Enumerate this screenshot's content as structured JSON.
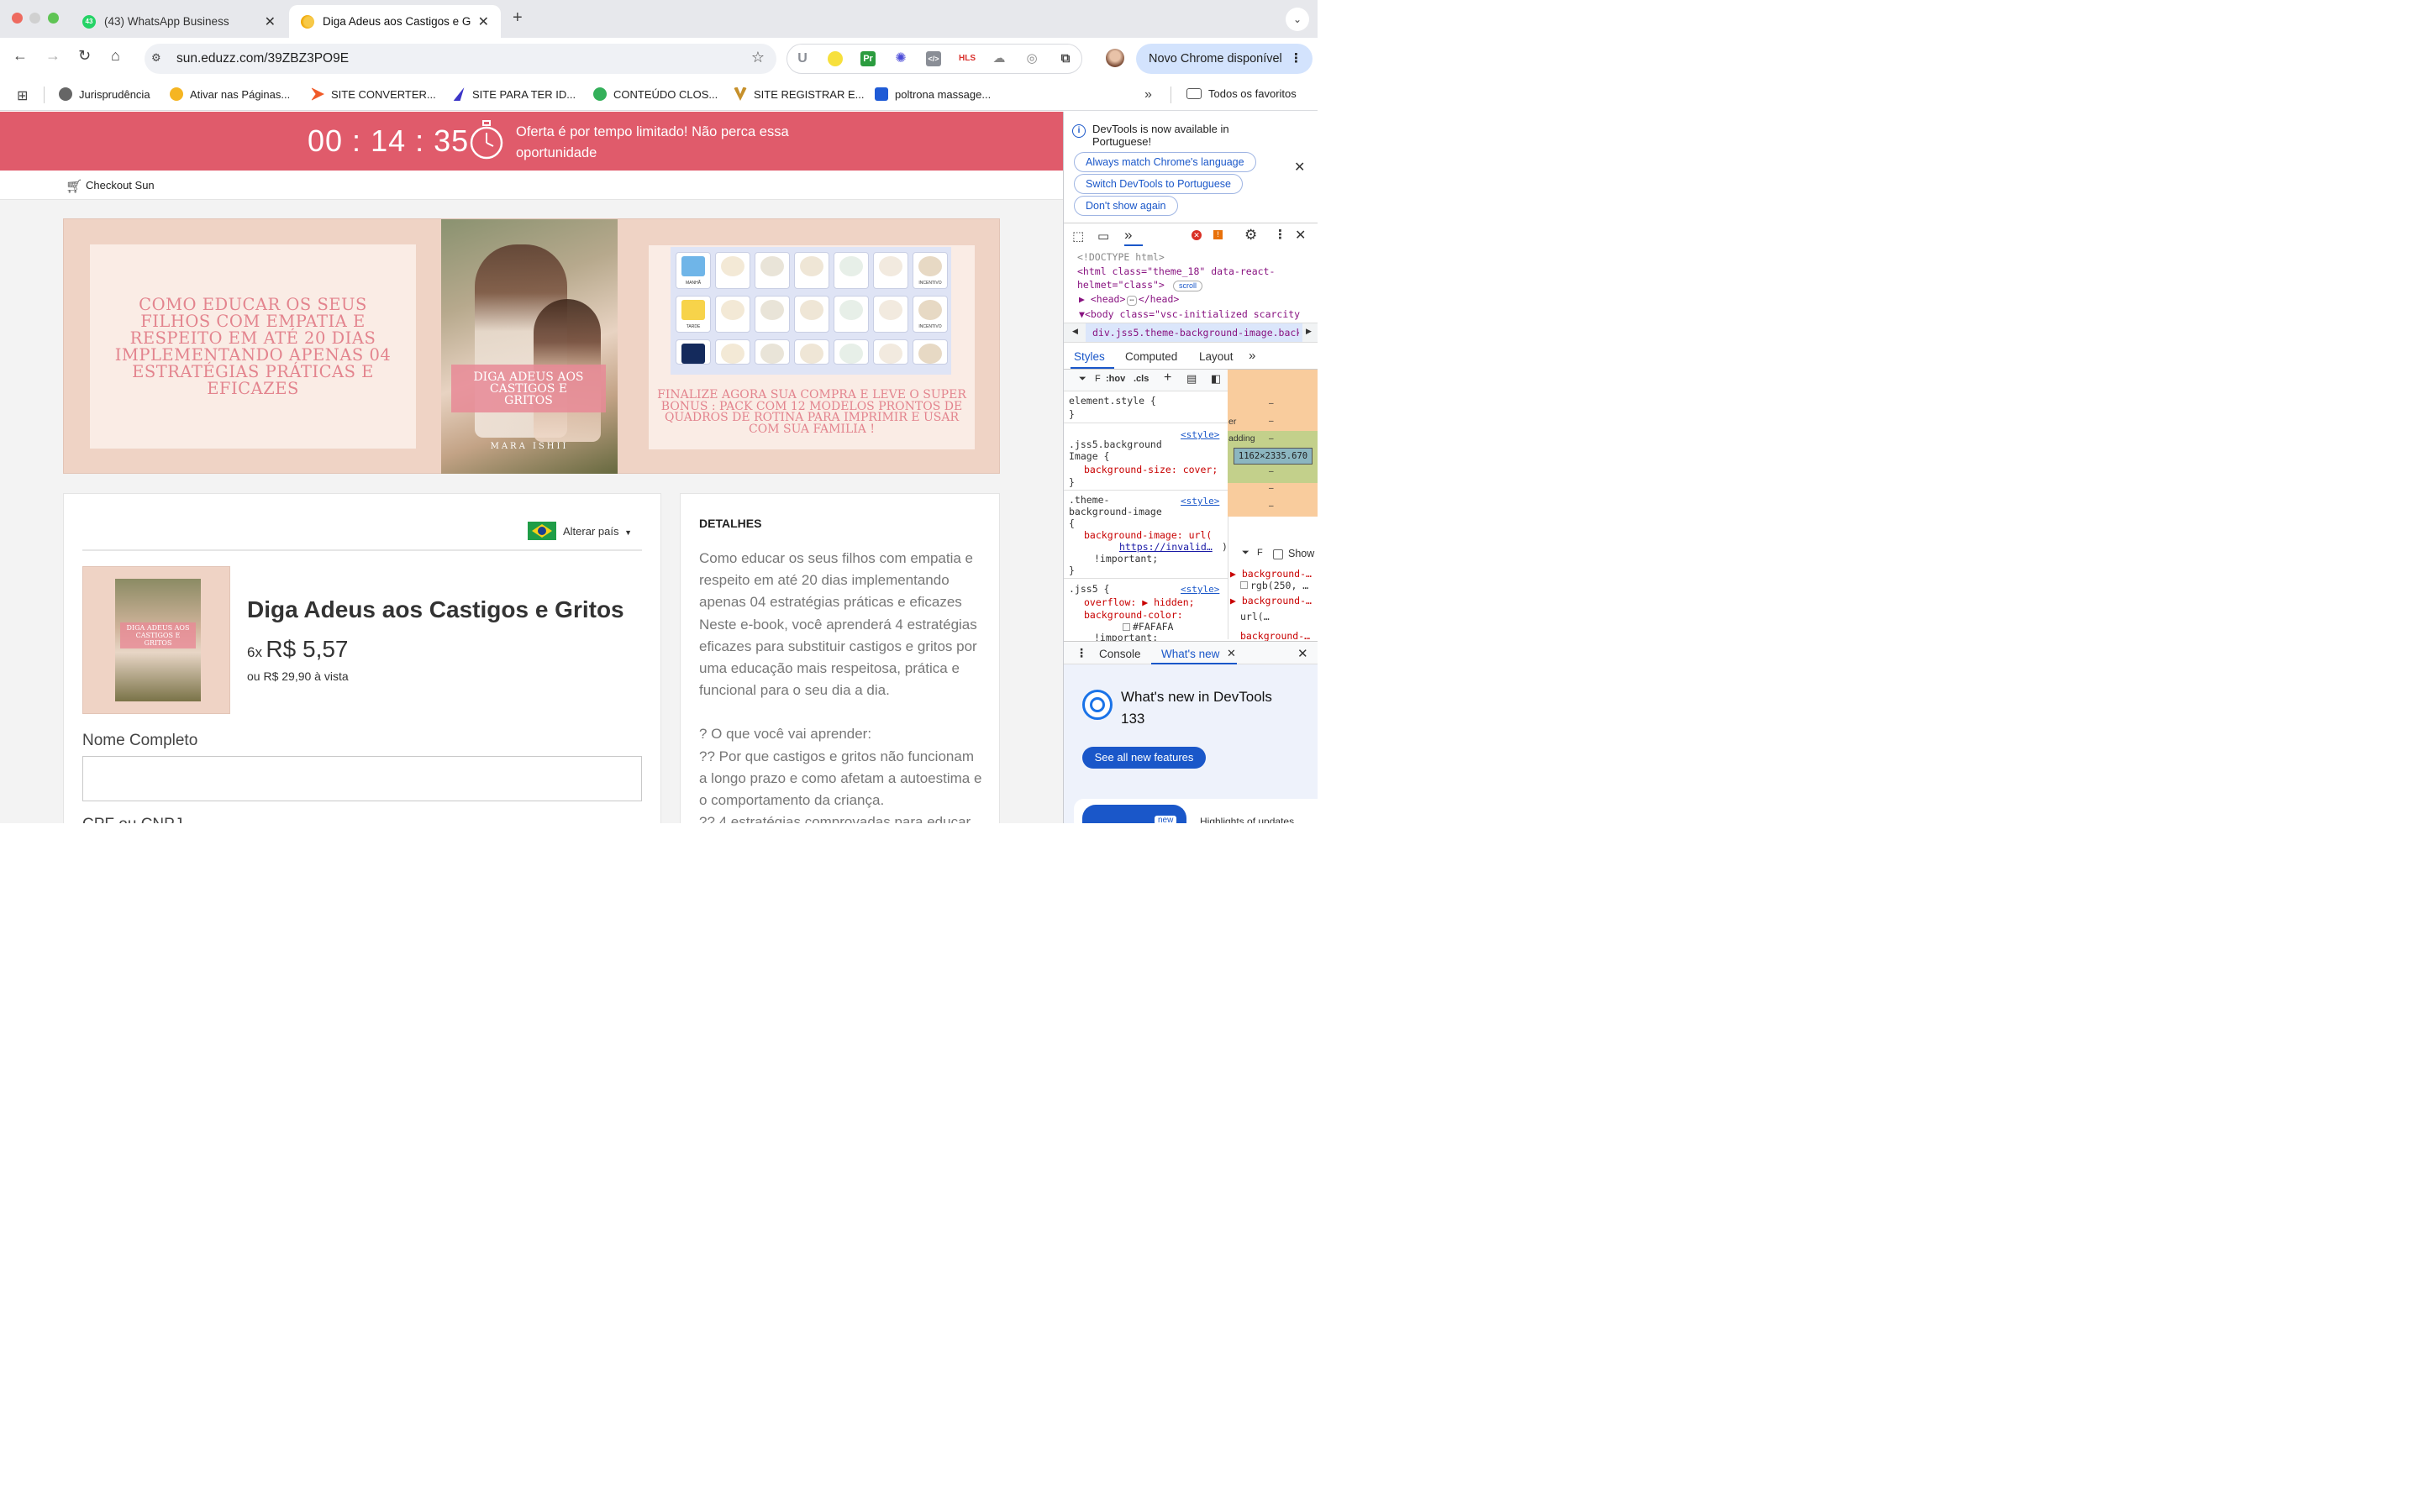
{
  "browser": {
    "tabs": [
      {
        "title": "(43) WhatsApp Business",
        "badge": "43"
      },
      {
        "title": "Diga Adeus aos Castigos e Gr"
      }
    ],
    "new_tab": "+",
    "url": "sun.eduzz.com/39ZBZ3PO9E",
    "update_button": "Novo Chrome disponível",
    "ext_labels": {
      "u": "U",
      "pr": "Pr",
      "hls": "HLS"
    },
    "bookmarks": [
      "Jurisprudência",
      "Ativar nas Páginas...",
      "SITE CONVERTER...",
      "SITE PARA TER ID...",
      "CONTEÚDO CLOS...",
      "SITE REGISTRAR E...",
      "poltrona massage..."
    ],
    "all_bookmarks": "Todos os favoritos"
  },
  "page": {
    "timer": {
      "hh": "00",
      "mm": "14",
      "ss": "35"
    },
    "offer_text": "Oferta é por tempo limitado! Não perca essa oportunidade",
    "checkout_label": "Checkout Sun",
    "hero": {
      "headline": "COMO EDUCAR OS SEUS FILHOS COM EMPATIA E RESPEITO EM ATÉ 20 DIAS IMPLEMENTANDO APENAS 04 ESTRATÉGIAS PRÁTICAS E EFICAZES",
      "book_title": "DIGA ADEUS AOS CASTIGOS E GRITOS",
      "author": "MARA ISHII",
      "bonus": "FINALIZE AGORA SUA COMPRA E LEVE O SUPER BONUS : PACK COM 12 MODELOS PRONTOS DE QUADROS DE ROTINA  PARA IMPRIMIR E USAR COM SUA FAMILIA !",
      "routine_labels": [
        "MANHÃ",
        "TARDE"
      ],
      "routine_incentive": "INCENTIVO"
    },
    "country_change": "Alterar país",
    "product": {
      "title": "Diga Adeus aos Castigos e Gritos",
      "installments": "6x",
      "installment_price": "R$ 5,57",
      "cash_price": "ou R$ 29,90 à vista",
      "thumb_title": "DIGA ADEUS AOS CASTIGOS E GRITOS"
    },
    "form": {
      "name_label": "Nome Completo",
      "name_value": "",
      "cpf_label": "CPF ou CNPJ"
    },
    "details": {
      "heading": "DETALHES",
      "lines": [
        "Como educar os seus filhos com empatia e respeito em até 20 dias implementando apenas 04 estratégias práticas e eficazes",
        "Neste e-book, você aprenderá 4 estratégias eficazes para substituir castigos e gritos por uma educação mais respeitosa, prática e funcional para o seu dia a dia.",
        "",
        "? O que você vai aprender:",
        "?? Por que castigos e gritos não funcionam a longo prazo e como afetam a autoestima e o comportamento da criança.",
        "?? 4 estratégias comprovadas para educar"
      ]
    }
  },
  "devtools": {
    "notice": "DevTools is now available in Portuguese!",
    "buttons": [
      "Always match Chrome's language",
      "Switch DevTools to Portuguese",
      "Don't show again"
    ],
    "dom": {
      "doctype": "<!DOCTYPE html>",
      "html_line1": "<html class=\"theme_18\" data-react-",
      "html_line2": "helmet=\"class\">",
      "scroll_badge": "scroll",
      "head": "<head>",
      "head_ellipsis": "⋯",
      "head_close": "</head>",
      "body": "<body class=\"vsc-initialized scarcity"
    },
    "breadcrumb": "div.jss5.theme-background-image.back",
    "panel_tabs": [
      "Styles",
      "Computed",
      "Layout"
    ],
    "filter": "F",
    "hov": ":hov",
    "cls": ".cls",
    "styles": {
      "element_style": "element.style {",
      "close": "}",
      "source": "<style>",
      "bg_selector1": ".jss5.background",
      "bg_selector2": "Image {",
      "bg_size": "background-size: cover;",
      "theme_selector1": ".theme-",
      "theme_selector2": "background-image",
      "theme_brace": "{",
      "bg_image": "background-image: url(",
      "bg_image_url": "https://invalid…",
      "bg_image_close": ")",
      "important": "!important;",
      "jss5_selector": ".jss5 {",
      "overflow": "overflow: ▶ hidden;",
      "bg_color": "background-color:",
      "bg_color_value": "#FAFAFA",
      "important_cut": "!important:"
    },
    "boxmodel": {
      "size": "1162×2335.670",
      "er": "er",
      "padding": "adding",
      "dash": "–"
    },
    "computed": {
      "filter": "F",
      "show": "Show",
      "rows": [
        "background-…",
        "rgb(250, …",
        "background-…",
        "url(…",
        "background-…"
      ]
    },
    "drawer_tabs": [
      "Console",
      "What's new"
    ],
    "whats_new_title": "What's new in DevTools 133",
    "see_all": "See all new features",
    "highlights": "Highlights of updates",
    "new_badge": "new"
  },
  "colors": {
    "banner": "#e05b6b",
    "accent": "#1a57c9",
    "hero_bg": "#efd3c5",
    "pink_text": "#e3848e"
  }
}
